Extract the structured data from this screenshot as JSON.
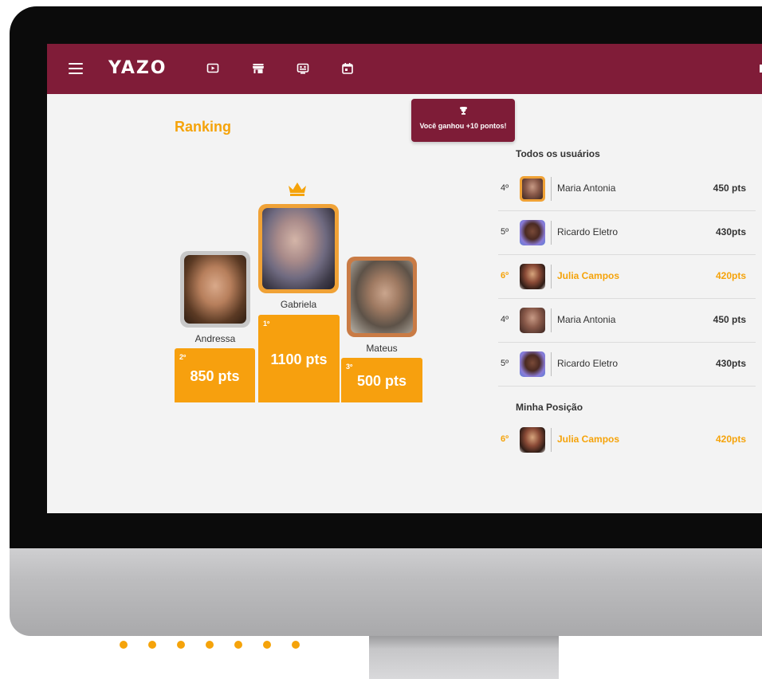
{
  "app": {
    "logo": "YAZO"
  },
  "topbar": {
    "icons": [
      "play-video-icon",
      "store-icon",
      "presentation-icon",
      "calendar-icon"
    ]
  },
  "toast": {
    "message": "Você ganhou +10 pontos!",
    "icon": "trophy-icon"
  },
  "ranking": {
    "title": "Ranking",
    "podium": {
      "first": {
        "place": "1º",
        "name": "Gabriela",
        "points": "1100 pts"
      },
      "second": {
        "place": "2º",
        "name": "Andressa",
        "points": "850 pts"
      },
      "third": {
        "place": "3º",
        "name": "Mateus",
        "points": "500 pts"
      }
    }
  },
  "list": {
    "all_title": "Todos os usuários",
    "rows": [
      {
        "pos": "4º",
        "name": "Maria Antonia",
        "points": "450 pts"
      },
      {
        "pos": "5º",
        "name": "Ricardo Eletro",
        "points": "430pts"
      },
      {
        "pos": "6º",
        "name": "Julia Campos",
        "points": "420pts"
      },
      {
        "pos": "4º",
        "name": "Maria Antonia",
        "points": "450 pts"
      },
      {
        "pos": "5º",
        "name": "Ricardo Eletro",
        "points": "430pts"
      }
    ],
    "my_title": "Minha Posição",
    "me": {
      "pos": "6º",
      "name": "Julia Campos",
      "points": "420pts"
    }
  },
  "colors": {
    "brand": "#801c38",
    "accent": "#f5a30a",
    "first_frame": "#f0a236",
    "second_frame": "#c8c8c8",
    "third_frame": "#c97b45"
  }
}
